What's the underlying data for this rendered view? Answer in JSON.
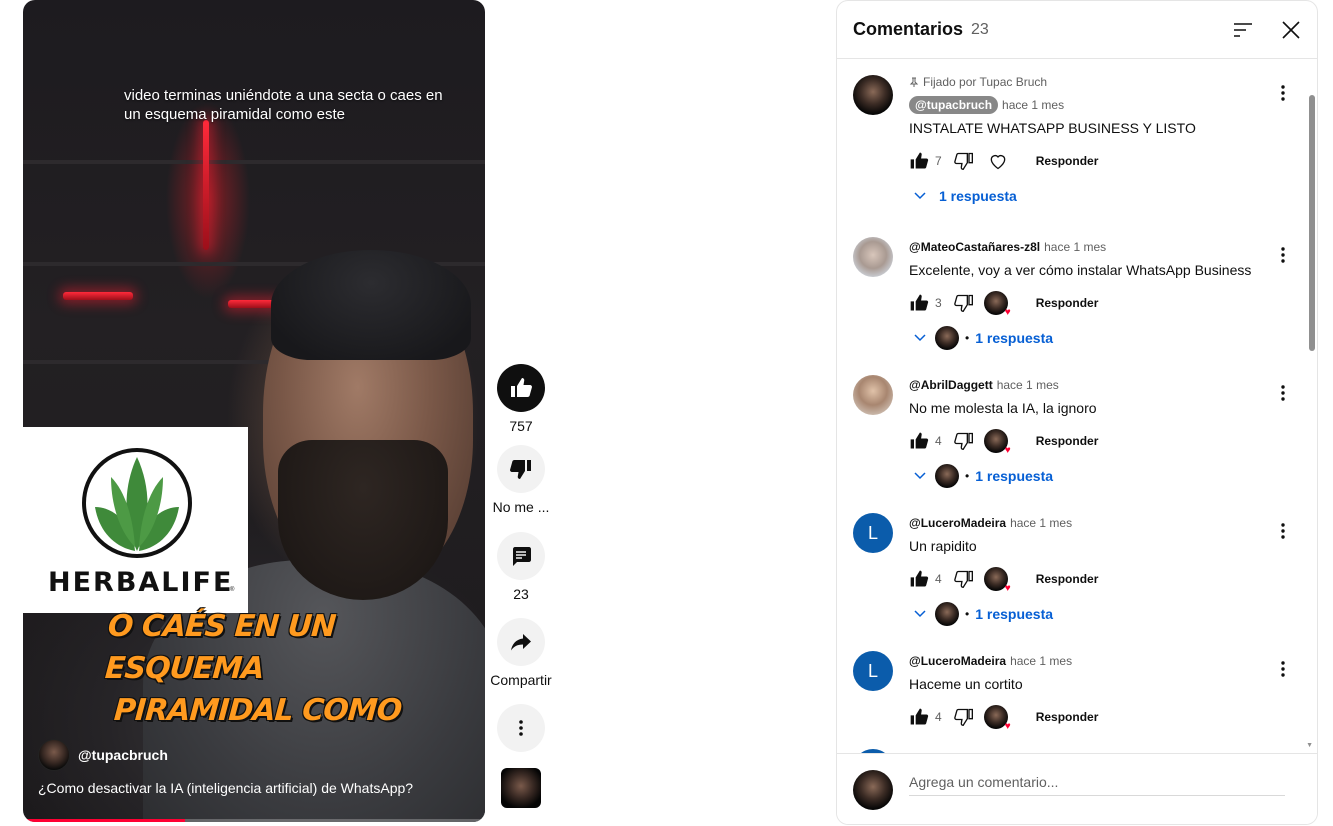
{
  "video": {
    "overlay_caption": "video terminas uniéndote a una secta o caes en un esquema piramidal como este",
    "logo_text": "HERBALIFE",
    "logo_reg": "®",
    "big_caption_line1": "O CAÉS EN UN ESQUEMA",
    "big_caption_line2": "PIRAMIDAL COMO",
    "channel": "@tupacbruch",
    "title": "¿Como desactivar la IA (inteligencia artificial) de WhatsApp?",
    "progress": 0.35
  },
  "rail": {
    "like_count": "757",
    "dislike_label": "No me ...",
    "comments_count": "23",
    "share_label": "Compartir"
  },
  "panel": {
    "title": "Comentarios",
    "count": "23",
    "composer_placeholder": "Agrega un comentario...",
    "comments": [
      {
        "pinned": "Fijado por Tupac Bruch",
        "author": "@tupacbruch",
        "time": "hace 1 mes",
        "text": "INSTALATE WHATSAPP BUSINESS Y LISTO",
        "likes": "7",
        "reply_label": "Responder",
        "replies": "1 respuesta"
      },
      {
        "author": "@MateoCastañares-z8l",
        "time": "hace 1 mes",
        "text": "Excelente, voy a ver cómo instalar WhatsApp Business",
        "likes": "3",
        "reply_label": "Responder",
        "replies": "1 respuesta"
      },
      {
        "author": "@AbrilDaggett",
        "time": "hace 1 mes",
        "text": "No me molesta la IA, la ignoro",
        "likes": "4",
        "reply_label": "Responder",
        "replies": "1 respuesta"
      },
      {
        "avatar_letter": "L",
        "author": "@LuceroMadeira",
        "time": "hace 1 mes",
        "text": "Un rapidito",
        "likes": "4",
        "reply_label": "Responder",
        "replies": "1 respuesta"
      },
      {
        "avatar_letter": "L",
        "author": "@LuceroMadeira",
        "time": "hace 1 mes",
        "text": "Haceme un cortito",
        "likes": "4",
        "reply_label": "Responder"
      }
    ]
  },
  "colors": {
    "accent_link": "#065fd4",
    "progress": "#ff0033",
    "heart": "#ff0033",
    "caption": "#ff9a1f",
    "logo_green": "#3f8a3a"
  },
  "icons": [
    "like-icon",
    "dislike-icon",
    "comment-icon",
    "share-icon",
    "more-vert-icon",
    "sort-icon",
    "close-icon",
    "pin-icon",
    "heart-icon",
    "chevron-down-icon"
  ]
}
